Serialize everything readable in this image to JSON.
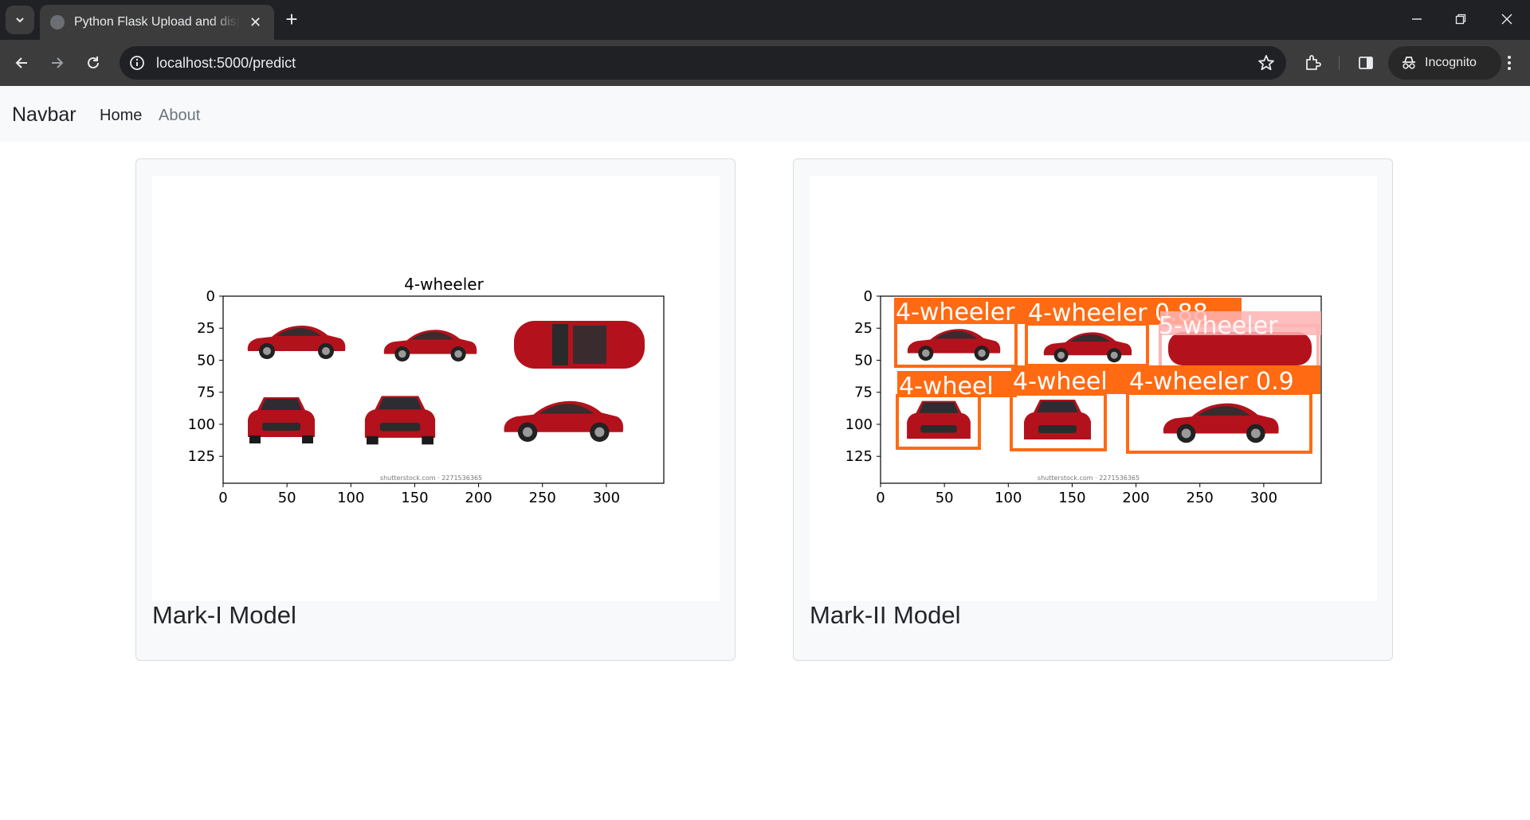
{
  "browser": {
    "tab_title": "Python Flask Upload and display image",
    "url": "localhost:5000/predict",
    "incognito_label": "Incognito",
    "icons": [
      "tab-search-icon",
      "globe-icon",
      "close-icon",
      "plus-icon",
      "minimize-icon",
      "restore-icon",
      "window-close-icon",
      "back-icon",
      "forward-icon",
      "reload-icon",
      "info-icon",
      "star-icon",
      "extensions-icon",
      "side-panel-icon",
      "incognito-icon",
      "menu-icon"
    ]
  },
  "navbar": {
    "brand": "Navbar",
    "home": "Home",
    "about": "About"
  },
  "cards": [
    {
      "title": "Mark-I Model",
      "plot_title": "4-wheeler",
      "x_ticks": [
        "0",
        "50",
        "100",
        "150",
        "200",
        "250",
        "300"
      ],
      "y_ticks": [
        "0",
        "25",
        "50",
        "75",
        "100",
        "125"
      ],
      "watermark": "shutterstock.com · 2271536365"
    },
    {
      "title": "Mark-II Model",
      "x_ticks": [
        "0",
        "50",
        "100",
        "150",
        "200",
        "250",
        "300"
      ],
      "y_ticks": [
        "0",
        "25",
        "50",
        "75",
        "100",
        "125"
      ],
      "watermark": "shutterstock.com · 2271536365",
      "detections": [
        {
          "label": "4-wheeler",
          "color": "#ff6a13"
        },
        {
          "label": "4-wheeler 0.88",
          "color": "#ff6a13"
        },
        {
          "label": "5-wheeler",
          "color": "#ffb3b3"
        },
        {
          "label": "4-wheel",
          "color": "#ff6a13"
        },
        {
          "label": "4-wheel",
          "color": "#ff6a13"
        },
        {
          "label": "4-wheeler 0.9",
          "color": "#ff6a13"
        }
      ]
    }
  ],
  "colors": {
    "car_red": "#b3121c",
    "detection_orange": "#ff6a13",
    "navbar_bg": "#f8f9fa"
  }
}
